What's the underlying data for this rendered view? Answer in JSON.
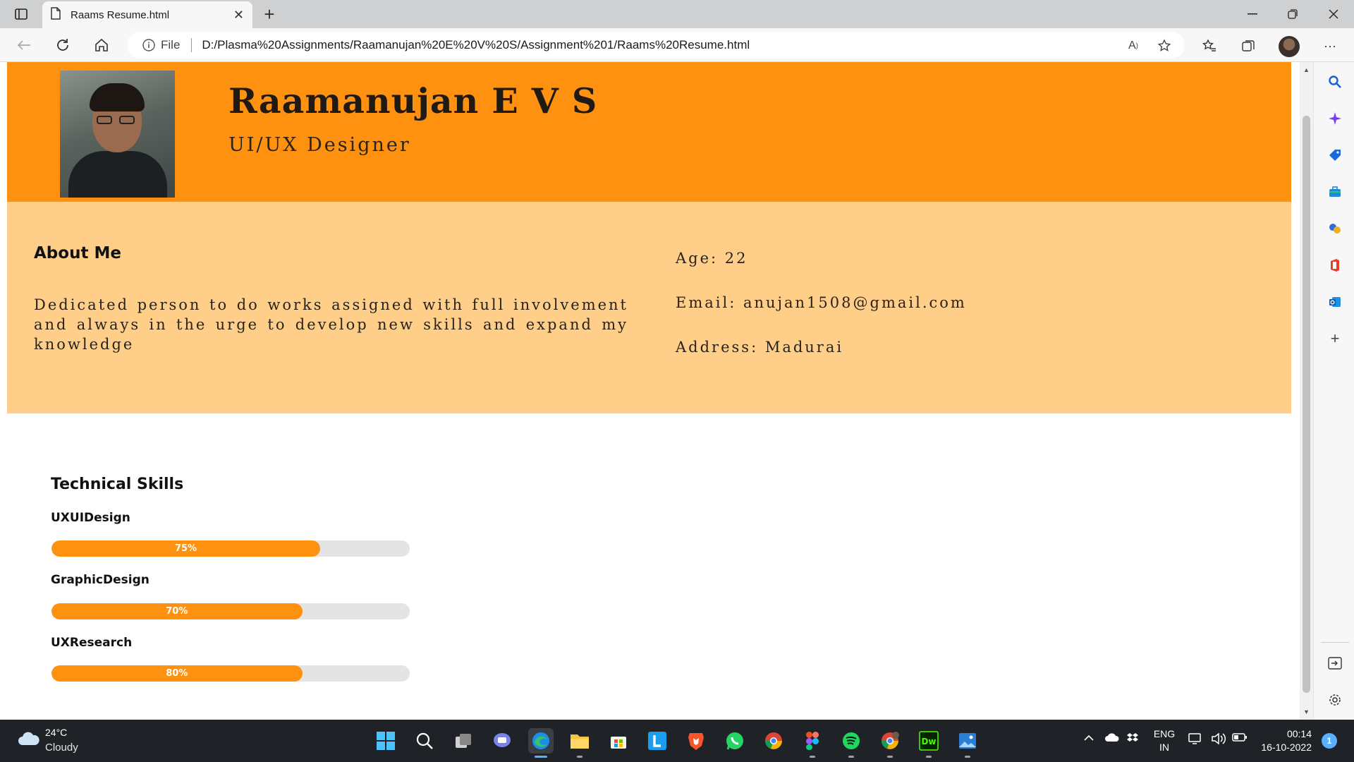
{
  "browser": {
    "tab_title": "Raams Resume.html",
    "new_tab_symbol": "+",
    "close_tab_symbol": "✕",
    "url_scheme_label": "File",
    "url": "D:/Plasma%20Assignments/Raamanujan%20E%20V%20S/Assignment%201/Raams%20Resume.html",
    "more_label": "···"
  },
  "resume": {
    "name": "Raamanujan E V S",
    "role": "UI/UX Designer",
    "about_heading": "About Me",
    "about_text": "Dedicated person to do works assigned with full involvement and always in the urge to develop new skills and expand my knowledge",
    "age": "Age: 22",
    "email": "Email: anujan1508@gmail.com",
    "address": "Address: Madurai",
    "skills_heading": "Technical Skills",
    "skills": [
      {
        "label": "UXUIDesign",
        "percent_label": "75%",
        "fill_fraction": 0.75
      },
      {
        "label": "GraphicDesign",
        "percent_label": "70%",
        "fill_fraction": 0.7
      },
      {
        "label": "UXResearch",
        "percent_label": "80%",
        "fill_fraction": 0.7
      }
    ]
  },
  "taskbar": {
    "temperature": "24°C",
    "condition": "Cloudy",
    "language_line1": "ENG",
    "language_line2": "IN",
    "time": "00:14",
    "date": "16-10-2022",
    "notification_count": "1"
  },
  "colors": {
    "hero": "#ff9110",
    "about_bg": "#ffcf8a",
    "bar_fill": "#ff9110",
    "bar_track": "#e4e4e4"
  }
}
